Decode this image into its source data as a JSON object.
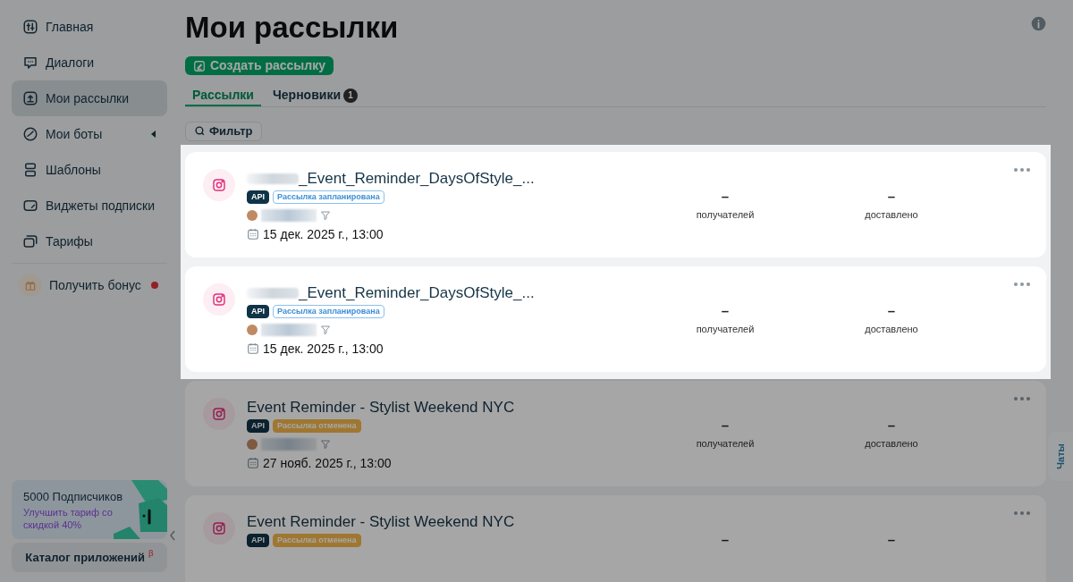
{
  "sidebar": {
    "items": [
      {
        "label": "Главная",
        "selected": false
      },
      {
        "label": "Диалоги",
        "selected": false
      },
      {
        "label": "Мои рассылки",
        "selected": true
      },
      {
        "label": "Мои боты",
        "selected": false,
        "expandable": true
      },
      {
        "label": "Шаблоны",
        "selected": false
      },
      {
        "label": "Виджеты подписки",
        "selected": false
      },
      {
        "label": "Тарифы",
        "selected": false
      }
    ],
    "bonus": {
      "label": "Получить бонус",
      "notification": true
    },
    "promo": {
      "title": "5000 Подписчиков",
      "text": "Улучшить тариф со скидкой 40%"
    },
    "catalog": {
      "label": "Каталог приложений",
      "badge": "β"
    }
  },
  "page": {
    "title": "Мои рассылки",
    "create_button": "Создать рассылку",
    "tabs": [
      {
        "label": "Рассылки",
        "selected": true
      },
      {
        "label": "Черновики",
        "count": "1",
        "selected": false
      }
    ],
    "filter_button": "Фильтр"
  },
  "tour_overlay": {
    "on": true
  },
  "campaigns": [
    {
      "spotlight": true,
      "title": "_Event_Reminder_DaysOfStyle_...",
      "redacted_prefix": true,
      "tags": [
        {
          "text": "API",
          "kind": "api"
        },
        {
          "text": "Рассылка запланирована",
          "kind": "scheduled"
        }
      ],
      "audience": true,
      "date": "15 дек. 2025 г., 13:00",
      "stats": [
        {
          "value": "–",
          "label": "получателей"
        },
        {
          "value": "–",
          "label": "доставлено"
        }
      ]
    },
    {
      "spotlight": true,
      "title": "_Event_Reminder_DaysOfStyle_...",
      "redacted_prefix": true,
      "tags": [
        {
          "text": "API",
          "kind": "api"
        },
        {
          "text": "Рассылка запланирована",
          "kind": "scheduled"
        }
      ],
      "audience": true,
      "date": "15 дек. 2025 г., 13:00",
      "stats": [
        {
          "value": "–",
          "label": "получателей"
        },
        {
          "value": "–",
          "label": "доставлено"
        }
      ]
    },
    {
      "spotlight": false,
      "title": "Event Reminder - Stylist Weekend NYC",
      "redacted_prefix": false,
      "tags": [
        {
          "text": "API",
          "kind": "api"
        },
        {
          "text": "Рассылка отменена",
          "kind": "cancelled"
        }
      ],
      "audience": true,
      "date": "27 нояб. 2025 г., 13:00",
      "stats": [
        {
          "value": "–",
          "label": "получателей"
        },
        {
          "value": "–",
          "label": "доставлено"
        }
      ]
    },
    {
      "spotlight": false,
      "title": "Event Reminder - Stylist Weekend NYC",
      "redacted_prefix": false,
      "tags": [
        {
          "text": "API",
          "kind": "api"
        },
        {
          "text": "Рассылка отменена",
          "kind": "cancelled"
        }
      ],
      "audience": false,
      "stats": [
        {
          "value": "–"
        },
        {
          "value": "–"
        }
      ]
    }
  ],
  "chat_tab": {
    "label": "Чаты"
  }
}
